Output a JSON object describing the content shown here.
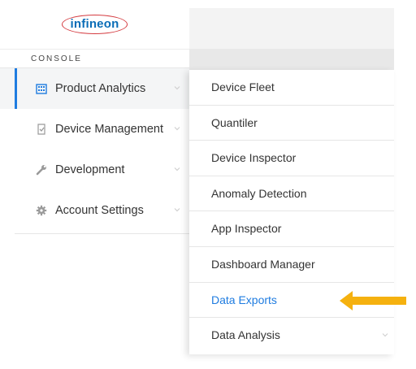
{
  "brand": {
    "logo_text": "infineon"
  },
  "sidebar": {
    "section_label": "CONSOLE",
    "items": [
      {
        "label": "Product Analytics",
        "icon": "building-icon",
        "active": true
      },
      {
        "label": "Device Management",
        "icon": "checklist-icon",
        "active": false
      },
      {
        "label": "Development",
        "icon": "wrench-icon",
        "active": false
      },
      {
        "label": "Account Settings",
        "icon": "gear-icon",
        "active": false
      }
    ]
  },
  "flyout": {
    "items": [
      {
        "label": "Device Fleet"
      },
      {
        "label": "Quantiler"
      },
      {
        "label": "Device Inspector"
      },
      {
        "label": "Anomaly Detection"
      },
      {
        "label": "App Inspector"
      },
      {
        "label": "Dashboard Manager"
      },
      {
        "label": "Data Exports",
        "highlighted": true
      },
      {
        "label": "Data Analysis",
        "has_submenu": true
      }
    ]
  },
  "colors": {
    "accent": "#1f7ce0",
    "arrow": "#f5b10f",
    "logo_blue": "#0b6db7",
    "logo_red": "#d43a3f"
  }
}
